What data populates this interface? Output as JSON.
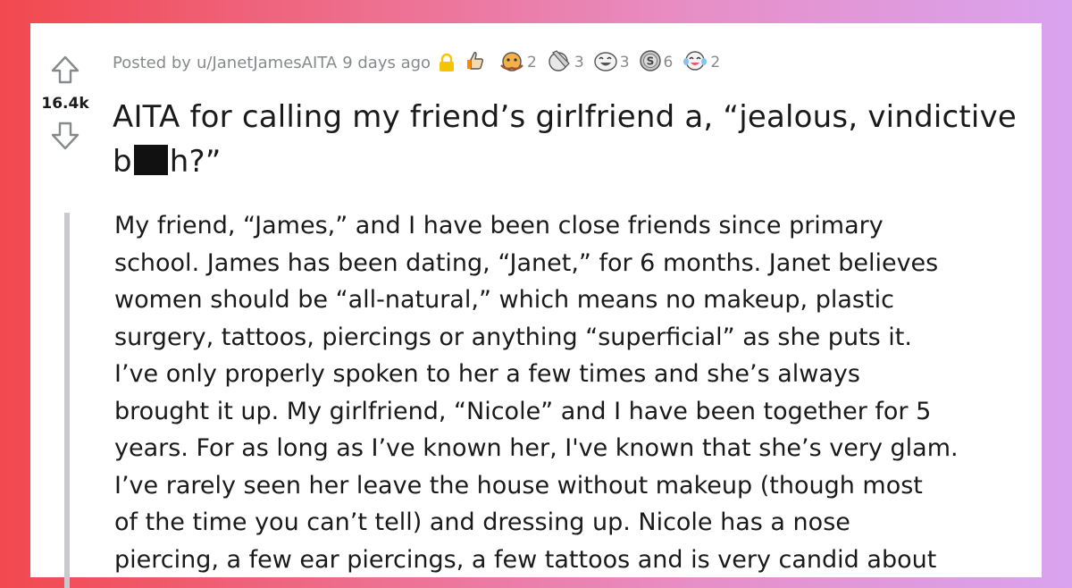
{
  "post": {
    "score": "16.4k",
    "posted_by_prefix": "Posted by",
    "author": "u/JanetJamesAITA",
    "age": "9 days ago",
    "awards": [
      {
        "icon": "wholesome-award-icon",
        "count": ""
      },
      {
        "icon": "hugz-award-icon",
        "count": "2"
      },
      {
        "icon": "facepalm-award-icon",
        "count": "3"
      },
      {
        "icon": "laughing-award-icon",
        "count": "3"
      },
      {
        "icon": "silver-award-icon",
        "count": "6"
      },
      {
        "icon": "tears-of-joy-award-icon",
        "count": "2"
      }
    ],
    "title_part1": "AITA for calling my friend’s girlfriend a, “jealous, vindictive b",
    "title_part2": "h?”",
    "body_lines": [
      "My friend, “James,” and I have been close friends since primary",
      "school. James has been dating, “Janet,” for 6 months. Janet believes",
      "women should be “all-natural,” which means no makeup, plastic",
      "surgery, tattoos, piercings or anything “superficial” as she puts it.",
      "I’ve only properly spoken to her a few times and she’s always",
      "brought it up. My girlfriend, “Nicole” and I have been together for 5",
      "years. For as long as I’ve known her, I've known that she’s very glam.",
      "I’ve rarely seen her leave the house without makeup (though most",
      "of the time you can’t tell) and dressing up. Nicole has a nose",
      "piercing, a few ear piercings, a few tattoos and is very candid about"
    ]
  }
}
